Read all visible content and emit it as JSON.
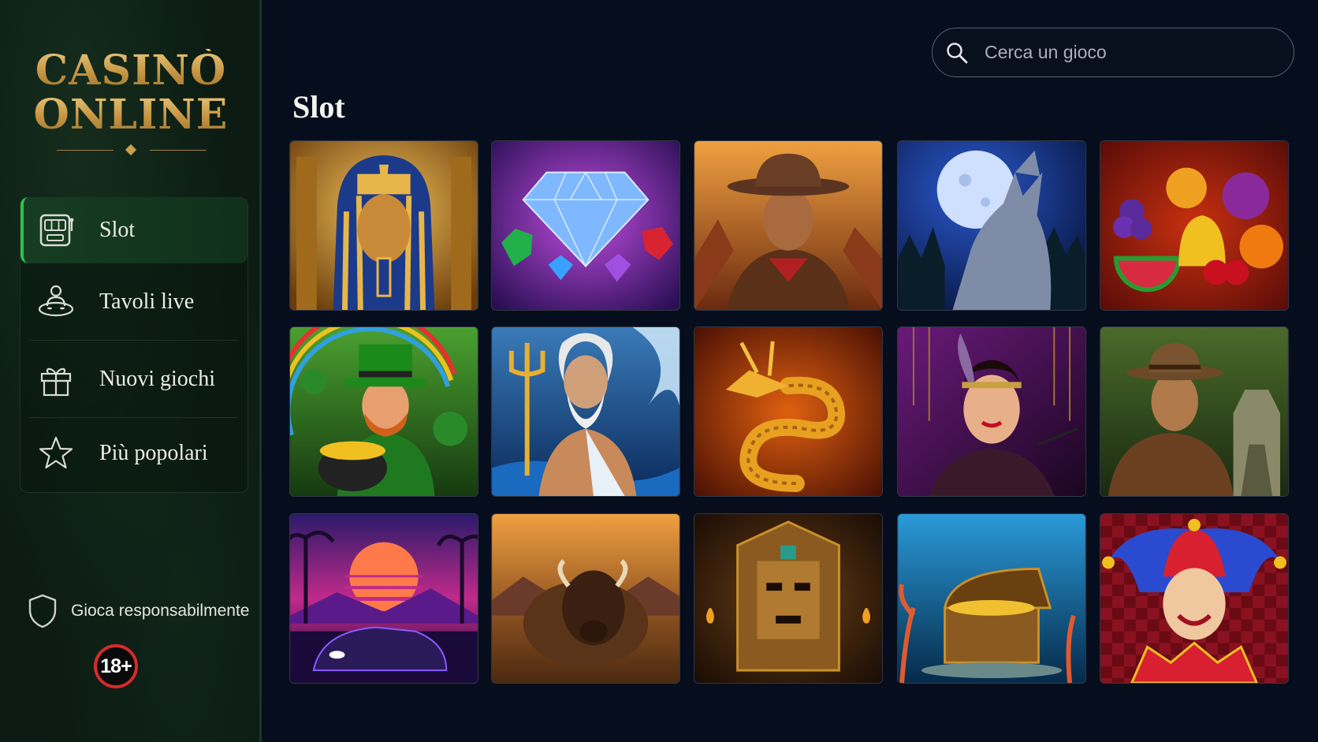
{
  "brand": {
    "line1": "CASINÒ",
    "line2": "ONLINE"
  },
  "search": {
    "placeholder": "Cerca un gioco"
  },
  "page": {
    "title": "Slot"
  },
  "nav": {
    "items": [
      {
        "label": "Slot",
        "icon": "slot-machine-icon",
        "active": true
      },
      {
        "label": "Tavoli live",
        "icon": "live-dealer-icon",
        "active": false
      },
      {
        "label": "Nuovi giochi",
        "icon": "gift-icon",
        "active": false
      },
      {
        "label": "Più popolari",
        "icon": "star-icon",
        "active": false
      }
    ]
  },
  "footer": {
    "responsible": "Gioca responsabilmente",
    "age": "18+"
  },
  "colors": {
    "accent_green": "#2dc24e",
    "gold": "#c9a04e",
    "badge_red": "#d62a2a",
    "background": "#060d1c"
  },
  "games": [
    {
      "theme": "pharaoh"
    },
    {
      "theme": "diamonds"
    },
    {
      "theme": "cowboy"
    },
    {
      "theme": "howling-wolf"
    },
    {
      "theme": "fruits-bell"
    },
    {
      "theme": "leprechaun"
    },
    {
      "theme": "poseidon"
    },
    {
      "theme": "golden-dragon"
    },
    {
      "theme": "flapper-woman"
    },
    {
      "theme": "jungle-explorer"
    },
    {
      "theme": "synthwave-car"
    },
    {
      "theme": "buffalo"
    },
    {
      "theme": "aztec-mask"
    },
    {
      "theme": "sunken-treasure"
    },
    {
      "theme": "jester"
    }
  ]
}
